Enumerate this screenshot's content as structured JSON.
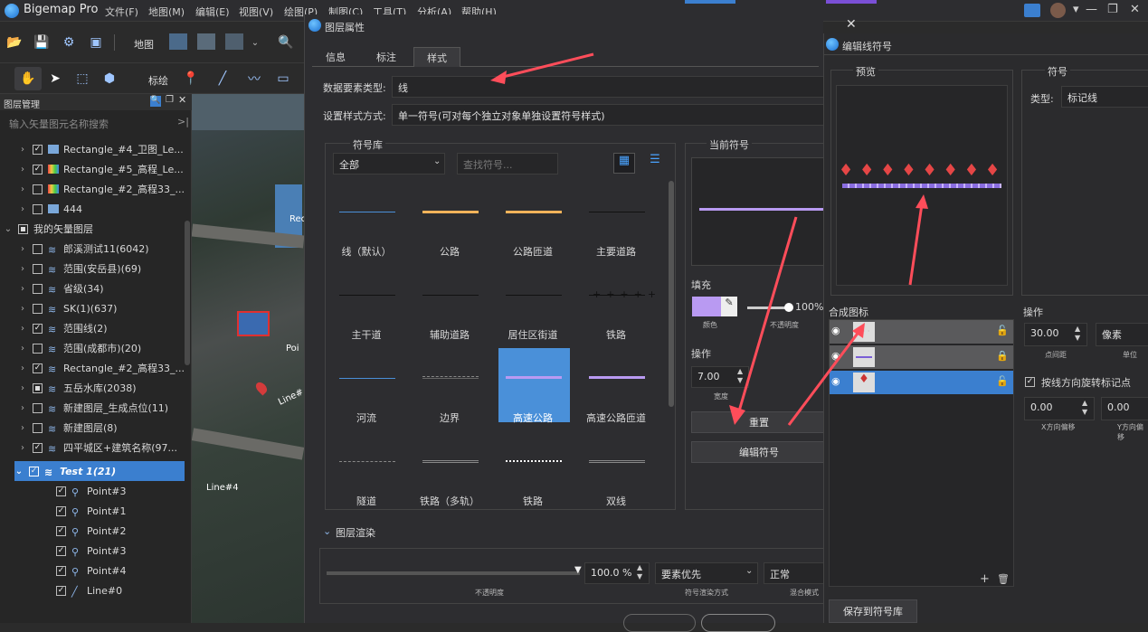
{
  "app": {
    "name": "Bigemap Pro",
    "menus": [
      "文件(F)",
      "地图(M)",
      "编辑(E)",
      "视图(V)",
      "绘图(P)",
      "制图(C)",
      "工具(T)",
      "分析(A)",
      "帮助(H)"
    ]
  },
  "toolbar": {
    "map_label": "地图",
    "draw_label": "标绘"
  },
  "layer_panel": {
    "title": "图层管理",
    "search_placeholder": "输入矢量图元名称搜索",
    "rows": [
      {
        "label": "Rectangle_#4_卫图_Le..."
      },
      {
        "label": "Rectangle_#5_高程_Le..."
      },
      {
        "label": "Rectangle_#2_高程33_..."
      },
      {
        "label": "444"
      },
      {
        "label": "我的矢量图层"
      },
      {
        "label": "郎溪测试11(6042)"
      },
      {
        "label": "范围(安岳县)(69)"
      },
      {
        "label": "省级(34)"
      },
      {
        "label": "SK(1)(637)"
      },
      {
        "label": "范围线(2)"
      },
      {
        "label": "范围(成都市)(20)"
      },
      {
        "label": "Rectangle_#2_高程33_..."
      },
      {
        "label": "五岳水库(2038)"
      },
      {
        "label": "新建图层_生成点位(11)"
      },
      {
        "label": "新建图层(8)"
      },
      {
        "label": "四平城区+建筑名称(97..."
      },
      {
        "label": "Test 1(21)"
      },
      {
        "label": "Point#3"
      },
      {
        "label": "Point#1"
      },
      {
        "label": "Point#2"
      },
      {
        "label": "Point#3"
      },
      {
        "label": "Point#4"
      },
      {
        "label": "Line#0"
      }
    ]
  },
  "map_labels": [
    "Rec",
    "Poi",
    "Line#",
    "Line#4"
  ],
  "dialog": {
    "title": "图层属性",
    "tabs": [
      "信息",
      "标注",
      "样式"
    ],
    "feature_type_label": "数据要素类型:",
    "feature_type_value": "线",
    "style_mode_label": "设置样式方式:",
    "style_mode_value": "单一符号(可对每个独立对象单独设置符号样式)",
    "symbol_lib_title": "符号库",
    "category_value": "全部",
    "search_placeholder": "查找符号...",
    "symbols": [
      "线（默认）",
      "公路",
      "公路匝道",
      "主要道路",
      "主干道",
      "辅助道路",
      "居住区街道",
      "铁路",
      "河流",
      "边界",
      "高速公路",
      "高速公路匝道",
      "隧道",
      "铁路（多轨）",
      "铁路",
      "双线"
    ],
    "current_symbol_title": "当前符号",
    "fill_label": "填充",
    "color_label": "颜色",
    "opacity_value": "100%",
    "opacity_label": "不透明度",
    "operation_label": "操作",
    "width_value": "7.00",
    "width_label": "宽度",
    "reset_button": "重置",
    "edit_symbol_button": "编辑符号",
    "render_title": "图层渲染",
    "render_opacity_value": "100.0 %",
    "render_opacity_label": "不透明度",
    "render_order_value": "要素优先",
    "render_order_label": "符号渲染方式",
    "blend_value": "正常",
    "blend_label": "混合模式"
  },
  "edit_symbol": {
    "title": "编辑线符号",
    "preview_label": "预览",
    "symbol_label": "符号",
    "type_label": "类型:",
    "type_value": "标记线",
    "composite_label": "合成图标",
    "operation_label": "操作",
    "spacing_value": "30.00",
    "spacing_label": "点间距",
    "unit_value": "像素",
    "unit_label": "单位",
    "rotate_label": "按线方向旋转标记点",
    "x_offset_value": "0.00",
    "x_offset_label": "X方向偏移",
    "y_offset_value": "0.00",
    "y_offset_label": "Y方向偏移",
    "save_button": "保存到符号库"
  },
  "colors": {
    "accent": "#3b7fcf",
    "line_purple": "#b99af2",
    "road_orange": "#f2b35a",
    "river_blue": "#4a8fd8",
    "arrow_red": "#ff4d5a"
  }
}
